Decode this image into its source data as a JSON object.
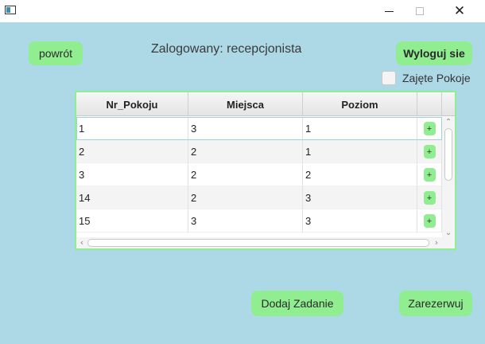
{
  "window": {
    "app_icon": "window-app-icon",
    "minimize_icon": "minimize-icon",
    "maximize_icon": "maximize-icon",
    "close_symbol": "✕"
  },
  "header": {
    "back_label": "powrót",
    "logged_text": "Zalogowany: recepcjonista",
    "logout_label": "Wyloguj sie"
  },
  "filter": {
    "occupied_label": "Zajęte Pokoje",
    "occupied_checked": false
  },
  "table": {
    "columns": [
      "Nr_Pokoju",
      "Miejsca",
      "Poziom",
      ""
    ],
    "add_symbol": "+",
    "rows": [
      [
        "1",
        "3",
        "1"
      ],
      [
        "2",
        "2",
        "1"
      ],
      [
        "3",
        "2",
        "2"
      ],
      [
        "14",
        "2",
        "3"
      ],
      [
        "15",
        "3",
        "3"
      ]
    ],
    "selected_row": 0
  },
  "footer": {
    "add_task_label": "Dodaj Zadanie",
    "reserve_label": "Zarezerwuj"
  },
  "colors": {
    "background": "#add8e6",
    "button": "#90ee90"
  }
}
